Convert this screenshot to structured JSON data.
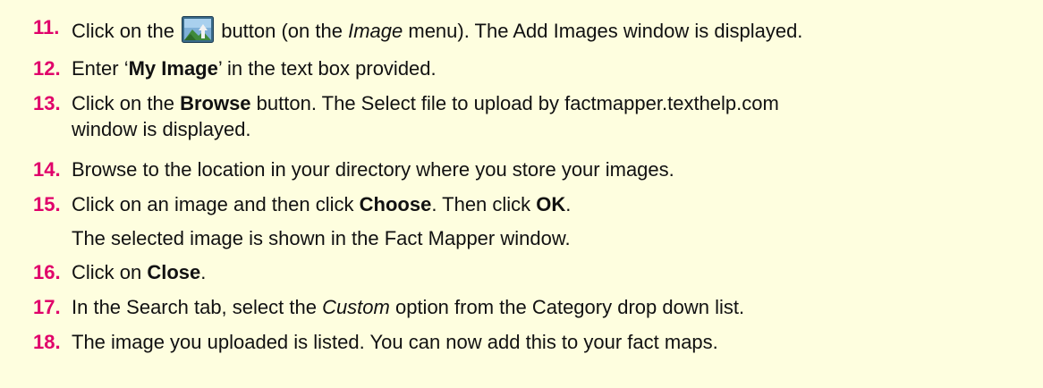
{
  "colors": {
    "background": "#fefedf",
    "step_number": "#e0006a",
    "text": "#111111"
  },
  "steps": [
    {
      "num": "11.",
      "before": "Click on the",
      "icon": "add-image-icon",
      "after_a": "button (on the ",
      "italic": "Image",
      "after_b": " menu). The Add Images window is displayed."
    },
    {
      "num": "12.",
      "a": "Enter ‘",
      "bold": "My Image",
      "b": "’ in the text box provided."
    },
    {
      "num": "13.",
      "a": "Click on the ",
      "bold": "Browse",
      "b": " button. The Select file to upload by factmapper.texthelp.com",
      "line2": "window is displayed."
    },
    {
      "num": "14.",
      "a": "Browse to the location in your directory where you store your images."
    },
    {
      "num": "15.",
      "a": "Click on an image and then click ",
      "bold1": "Choose",
      "b": ". Then click ",
      "bold2": "OK",
      "c": ".",
      "line2": "The selected image is shown in the Fact Mapper window."
    },
    {
      "num": "16.",
      "a": "Click on ",
      "bold": "Close",
      "b": "."
    },
    {
      "num": "17.",
      "a": "In the Search tab, select the ",
      "italic": "Custom",
      "b": " option from the Category drop down list."
    },
    {
      "num": "18.",
      "a": "The image you uploaded is listed. You can now add this to your fact maps."
    }
  ]
}
